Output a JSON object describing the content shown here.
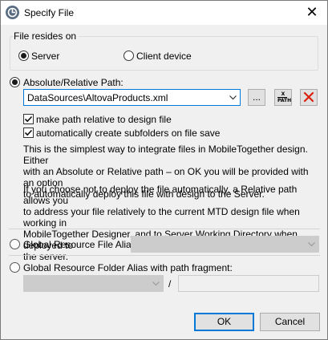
{
  "window": {
    "title": "Specify File",
    "close_icon": "close-icon",
    "app_icon": "altova-app-icon"
  },
  "location": {
    "group_label": "File resides on",
    "options": [
      {
        "label": "Server",
        "selected": true
      },
      {
        "label": "Client device",
        "selected": false
      }
    ]
  },
  "absolute": {
    "radio_label": "Absolute/Relative Path:",
    "selected": true,
    "path_value": "DataSources\\AltovaProducts.xml",
    "browse_label": "...",
    "xpath_label_top": "X",
    "xpath_label_bottom": "PATH",
    "checkboxes": [
      {
        "label": "make path relative to design file",
        "checked": true
      },
      {
        "label": "automatically create subfolders on file save",
        "checked": true
      }
    ],
    "para1": [
      "This is the simplest way to integrate files in MobileTogether design. Either",
      "with an Absolute or Relative path – on OK you will be provided with an option",
      "to automatically deploy this file with design to the Server."
    ],
    "para2": [
      "If you choose not to deploy the file automatically, a Relative path allows you",
      "to address your file relatively to the current MTD design file when working in",
      "MobileTogether Designer, and to Server Working Directory when deployed to",
      "the server."
    ]
  },
  "global_file": {
    "radio_label": "Global Resource File Alias:",
    "selected": false
  },
  "global_folder": {
    "radio_label": "Global Resource Folder Alias with path fragment:",
    "selected": false,
    "separator": "/"
  },
  "buttons": {
    "ok": "OK",
    "cancel": "Cancel"
  },
  "colors": {
    "accent": "#0078d7",
    "delete_red": "#d9230f",
    "dialog_bg": "#f0f0f0"
  }
}
